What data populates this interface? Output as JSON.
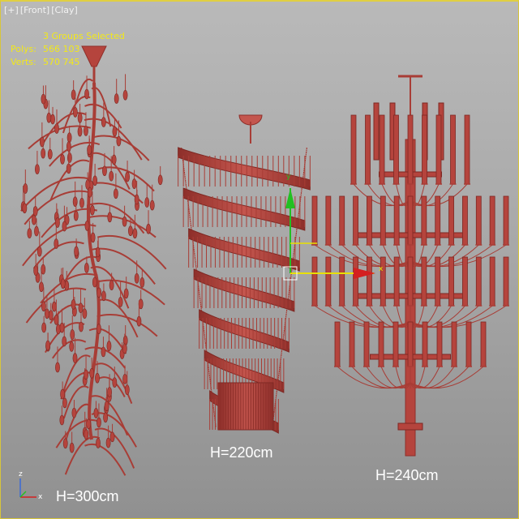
{
  "viewport": {
    "label_parts": [
      "[+]",
      "[Front]",
      "[Clay]"
    ],
    "border_color": "#d7c53a"
  },
  "stats": {
    "title": "3 Groups Selected",
    "polys_label": "Polys:",
    "polys_value": "566 103",
    "verts_label": "Verts:",
    "verts_value": "570 745",
    "color": "#f2e81a"
  },
  "models": {
    "left": {
      "name": "branch-chandelier",
      "height_label": "H=300cm"
    },
    "middle": {
      "name": "spiral-chandelier",
      "height_label": "H=220cm"
    },
    "right": {
      "name": "tiered-candle-chandelier",
      "height_label": "H=240cm"
    },
    "clay_color": "#b5443d"
  },
  "gizmo": {
    "x_label": "x",
    "y_label": "y",
    "x_color": "#e8e000",
    "y_color": "#22c022"
  },
  "axis_tripod": {
    "z_label": "z",
    "x_label": "x"
  }
}
